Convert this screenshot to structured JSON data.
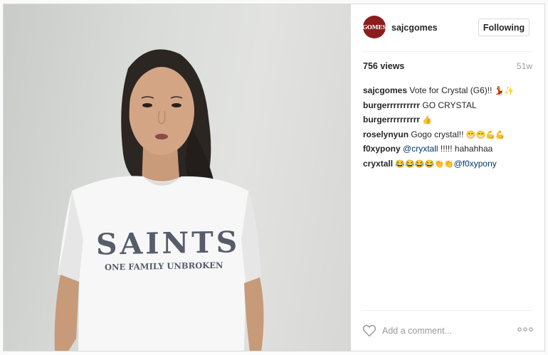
{
  "media": {
    "shirt_main_text": "SAINTS",
    "shirt_sub_text": "ONE FAMILY UNBROKEN"
  },
  "header": {
    "avatar_text": "GOMES",
    "username": "sajcgomes",
    "follow_label": "Following"
  },
  "stats": {
    "views": "756 views",
    "age": "51w"
  },
  "comments": [
    {
      "user": "sajcgomes",
      "text": "Vote for Crystal (G6)!!",
      "emoji": "💃✨"
    },
    {
      "user": "burgerrrrrrrrrr",
      "text": "GO CRYSTAL",
      "emoji": ""
    },
    {
      "user": "burgerrrrrrrrrr",
      "text": "",
      "emoji": "👍"
    },
    {
      "user": "roselynyun",
      "text": "Gogo crystal!!",
      "emoji": "😁😁💪💪"
    },
    {
      "user": "f0xypony",
      "mention": "@cryxtall",
      "text": "!!!!! hahahhaa",
      "emoji": ""
    },
    {
      "user": "cryxtall",
      "emoji": "😂😂😂😂👏👏",
      "mention": "@f0xypony"
    }
  ],
  "footer": {
    "comment_placeholder": "Add a comment...",
    "heart_icon": "heart-outline-icon",
    "more_icon": "more-options-icon"
  },
  "colors": {
    "avatar_bg": "#8c1d1d",
    "mention": "#003569",
    "muted": "#999999"
  }
}
